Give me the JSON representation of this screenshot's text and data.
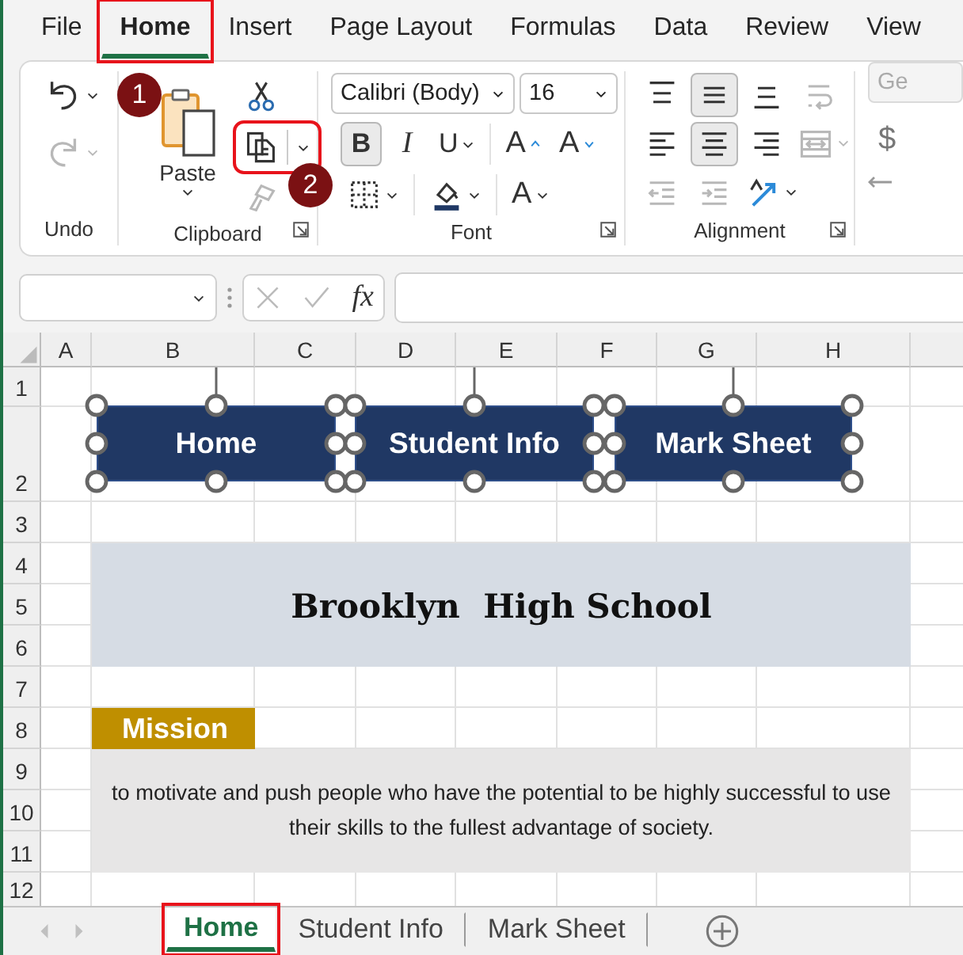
{
  "menu_tabs": [
    {
      "label": "File",
      "selected": false,
      "highlighted": false
    },
    {
      "label": "Home",
      "selected": true,
      "highlighted": true
    },
    {
      "label": "Insert",
      "selected": false,
      "highlighted": false
    },
    {
      "label": "Page Layout",
      "selected": false,
      "highlighted": false
    },
    {
      "label": "Formulas",
      "selected": false,
      "highlighted": false
    },
    {
      "label": "Data",
      "selected": false,
      "highlighted": false
    },
    {
      "label": "Review",
      "selected": false,
      "highlighted": false
    },
    {
      "label": "View",
      "selected": false,
      "highlighted": false
    }
  ],
  "ribbon": {
    "undo": {
      "label": "Undo",
      "buttons": [
        {
          "kind": "undo",
          "disabled": false
        },
        {
          "kind": "redo",
          "disabled": true
        }
      ]
    },
    "clipboard": {
      "label": "Clipboard",
      "launcher": true,
      "paste_label": "Paste",
      "tools": [
        {
          "kind": "cut",
          "disabled": false,
          "highlighted": false,
          "dropdown": false
        },
        {
          "kind": "copy",
          "disabled": false,
          "highlighted": true,
          "dropdown": true
        },
        {
          "kind": "format-painter",
          "disabled": true,
          "highlighted": false,
          "dropdown": false
        }
      ]
    },
    "font": {
      "label": "Font",
      "launcher": true,
      "font_name": "Calibri (Body)",
      "font_size": "16",
      "style_buttons": [
        {
          "kind": "bold",
          "label": "B",
          "pressed": true,
          "dropdown": false
        },
        {
          "kind": "italic",
          "label": "I",
          "pressed": false,
          "dropdown": false
        },
        {
          "kind": "underline",
          "label": "U",
          "pressed": false,
          "dropdown": true
        },
        {
          "kind": "grow",
          "label": "A",
          "pressed": false,
          "dropdown": false
        },
        {
          "kind": "shrink",
          "label": "A",
          "pressed": false,
          "dropdown": false
        }
      ],
      "format_buttons": [
        {
          "kind": "borders",
          "dropdown": true
        },
        {
          "kind": "fill",
          "dropdown": true
        },
        {
          "kind": "font-color",
          "label": "A",
          "dropdown": true
        }
      ]
    },
    "alignment": {
      "label": "Alignment",
      "launcher": true,
      "rows": [
        [
          {
            "kind": "align-top",
            "pressed": false,
            "disabled": false,
            "dropdown": false
          },
          {
            "kind": "align-middle",
            "pressed": true,
            "disabled": false,
            "dropdown": false
          },
          {
            "kind": "align-bottom",
            "pressed": false,
            "disabled": false,
            "dropdown": false
          },
          {
            "kind": "wrap-text",
            "pressed": false,
            "disabled": true,
            "dropdown": false
          }
        ],
        [
          {
            "kind": "align-left",
            "pressed": false,
            "disabled": false,
            "dropdown": false
          },
          {
            "kind": "align-center",
            "pressed": true,
            "disabled": false,
            "dropdown": false
          },
          {
            "kind": "align-right",
            "pressed": false,
            "disabled": false,
            "dropdown": false
          },
          {
            "kind": "merge",
            "pressed": false,
            "disabled": true,
            "dropdown": true
          }
        ],
        [
          {
            "kind": "indent-decrease",
            "pressed": false,
            "disabled": true,
            "dropdown": false
          },
          {
            "kind": "indent-increase",
            "pressed": false,
            "disabled": true,
            "dropdown": false
          },
          {
            "kind": "orientation",
            "pressed": false,
            "disabled": false,
            "dropdown": true
          }
        ]
      ]
    },
    "number": {
      "format": "Ge",
      "currency": "$"
    }
  },
  "badges": [
    {
      "label": "1"
    },
    {
      "label": "2"
    }
  ],
  "formula_bar": {
    "function_label": "fx"
  },
  "sheet": {
    "columns": [
      "A",
      "B",
      "C",
      "D",
      "E",
      "F",
      "G",
      "H"
    ],
    "rows": [
      "1",
      "2",
      "3",
      "4",
      "5",
      "6",
      "7",
      "8",
      "9",
      "10",
      "11",
      "12"
    ],
    "title": "Brooklyn  High School",
    "mission_heading": "Mission",
    "mission_text": "to motivate and push people who have the potential to be highly successful to use their skills to the fullest advantage of society.",
    "shapes": [
      {
        "label": "Home",
        "selected": true
      },
      {
        "label": "Student Info",
        "selected": true
      },
      {
        "label": "Mark Sheet",
        "selected": true
      }
    ]
  },
  "sheet_tabs": [
    {
      "label": "Home",
      "selected": true,
      "highlighted": true
    },
    {
      "label": "Student Info",
      "selected": false,
      "highlighted": false
    },
    {
      "label": "Mark Sheet",
      "selected": false,
      "highlighted": false
    }
  ]
}
